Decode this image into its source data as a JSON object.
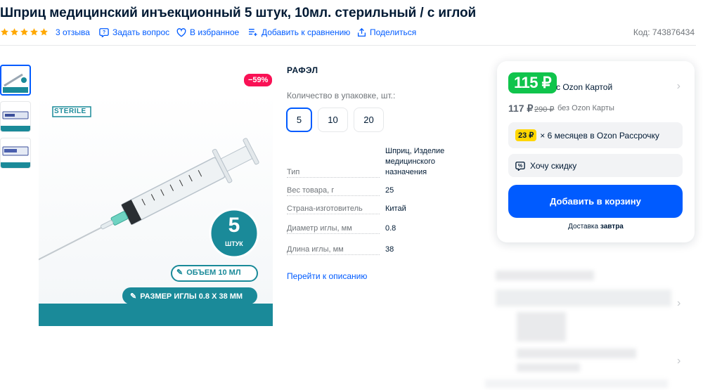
{
  "product": {
    "title": "Шприц медицинский инъекционный 5 штук, 10мл. стерильный / с иглой",
    "reviews": "3 отзыва",
    "ask": "Задать вопрос",
    "favorite": "В избранное",
    "compare": "Добавить к сравнению",
    "share": "Поделиться",
    "code": "Код: 743876434",
    "rating_stars": 5
  },
  "image": {
    "discount": "−59%",
    "sterile": "STERILE",
    "count_number": "5",
    "count_unit": "ШТУК",
    "volume": "ОБЪЕМ 10 МЛ",
    "needle": "РАЗМЕР ИГЛЫ 0.8 Х 38 ММ"
  },
  "details": {
    "brand": "РАФЭЛ",
    "qty_label": "Количество в упаковке, шт.:",
    "qty_options": [
      "5",
      "10",
      "20"
    ],
    "specs": [
      {
        "key": "Тип",
        "value": "Шприц, Изделие медицинского назначения"
      },
      {
        "key": "Вес товара, г",
        "value": "25"
      },
      {
        "key": "Страна-изготовитель",
        "value": "Китай"
      },
      {
        "key": "Диаметр иглы, мм",
        "value": "0.8"
      },
      {
        "key": "Длина иглы, мм",
        "value": "38"
      }
    ],
    "desc_link": "Перейти к описанию"
  },
  "price": {
    "card_price": "115 ₽",
    "card_note": "с Ozon Картой",
    "regular_price": "117 ₽",
    "old_price": "290 ₽",
    "regular_note": "без Ozon Карты",
    "installment_badge": "23 ₽",
    "installment_text": "× 6 месяцев в Ozon Рассрочку",
    "want_discount": "Хочу скидку",
    "add_to_cart": "Добавить в корзину",
    "delivery_prefix": "Доставка",
    "delivery_day": "завтра"
  },
  "colors": {
    "accent": "#005bff",
    "green_price": "#10c44c",
    "discount_red": "#f91155",
    "star": "#ffa800",
    "teal": "#1a8a99"
  }
}
